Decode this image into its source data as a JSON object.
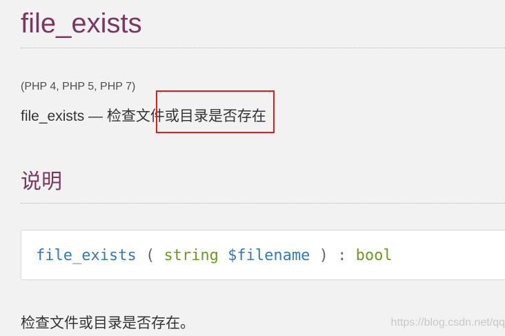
{
  "page": {
    "title": "file_exists",
    "version": "(PHP 4, PHP 5, PHP 7)",
    "refpurpose": "file_exists — 检查文件或目录是否存在"
  },
  "section": {
    "title": "说明"
  },
  "synopsis": {
    "function_name": "file_exists",
    "open_paren": " ( ",
    "param_type": "string",
    "param_name": " $filename",
    "close_paren": " ) : ",
    "return_type": "bool"
  },
  "description": "检查文件或目录是否存在。",
  "watermark": "https://blog.csdn.net/qq",
  "colors": {
    "title": "#793862",
    "highlight_border": "#e01a1a",
    "function_name": "#337ab7",
    "type": "#6d9a1c"
  }
}
